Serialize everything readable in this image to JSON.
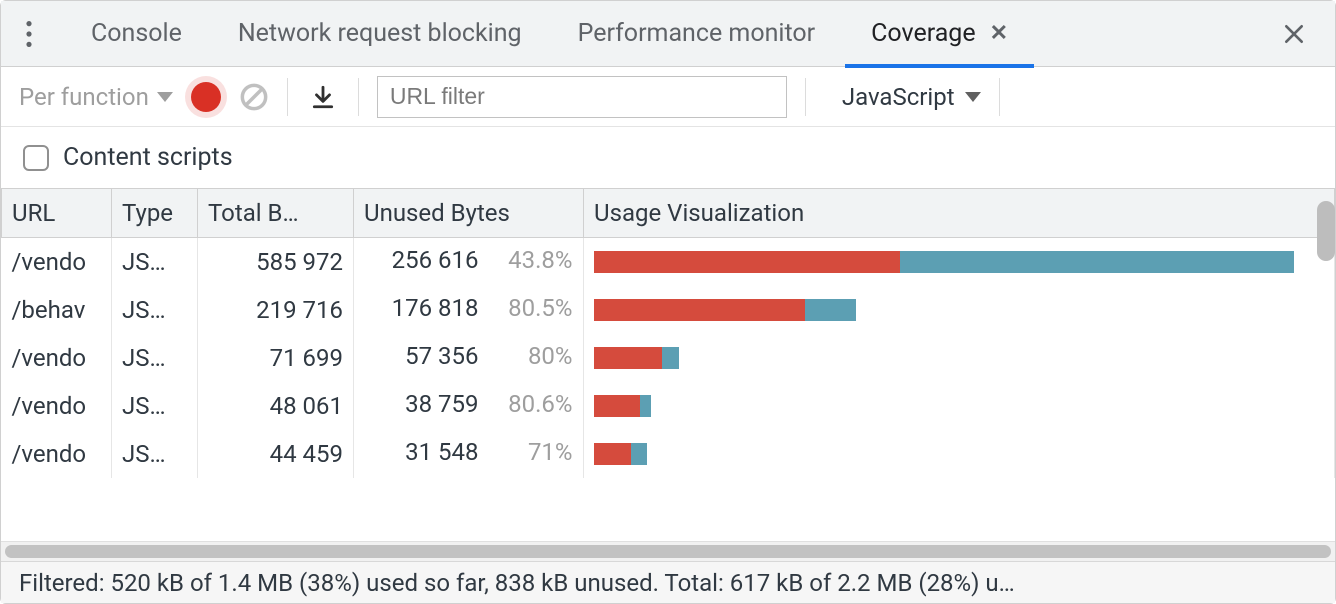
{
  "tabs": {
    "items": [
      {
        "label": "Console",
        "active": false,
        "closable": false
      },
      {
        "label": "Network request blocking",
        "active": false,
        "closable": false
      },
      {
        "label": "Performance monitor",
        "active": false,
        "closable": false
      },
      {
        "label": "Coverage",
        "active": true,
        "closable": true
      }
    ]
  },
  "toolbar": {
    "granularity_label": "Per function",
    "url_filter_placeholder": "URL filter",
    "type_filter_label": "JavaScript"
  },
  "options": {
    "content_scripts_label": "Content scripts",
    "content_scripts_checked": false
  },
  "table": {
    "headers": {
      "url": "URL",
      "type": "Type",
      "total": "Total B…",
      "unused": "Unused Bytes",
      "vis": "Usage Visualization"
    },
    "max_total": 585972,
    "rows": [
      {
        "url": "/vendo",
        "type": "JS…",
        "total": "585 972",
        "unused": "256 616",
        "pct": "43.8%",
        "total_num": 585972,
        "unused_num": 256616
      },
      {
        "url": "/behav",
        "type": "JS…",
        "total": "219 716",
        "unused": "176 818",
        "pct": "80.5%",
        "total_num": 219716,
        "unused_num": 176818
      },
      {
        "url": "/vendo",
        "type": "JS…",
        "total": "71 699",
        "unused": "57 356",
        "pct": "80%",
        "total_num": 71699,
        "unused_num": 57356
      },
      {
        "url": "/vendo",
        "type": "JS…",
        "total": "48 061",
        "unused": "38 759",
        "pct": "80.6%",
        "total_num": 48061,
        "unused_num": 38759
      },
      {
        "url": "/vendo",
        "type": "JS…",
        "total": "44 459",
        "unused": "31 548",
        "pct": "71%",
        "total_num": 44459,
        "unused_num": 31548
      }
    ]
  },
  "status": {
    "text": "Filtered: 520 kB of 1.4 MB (38%) used so far, 838 kB unused. Total: 617 kB of 2.2 MB (28%) u…"
  },
  "colors": {
    "unused": "#d54b3d",
    "used": "#5c9fb3",
    "accent": "#1a73e8",
    "record": "#d93025"
  }
}
